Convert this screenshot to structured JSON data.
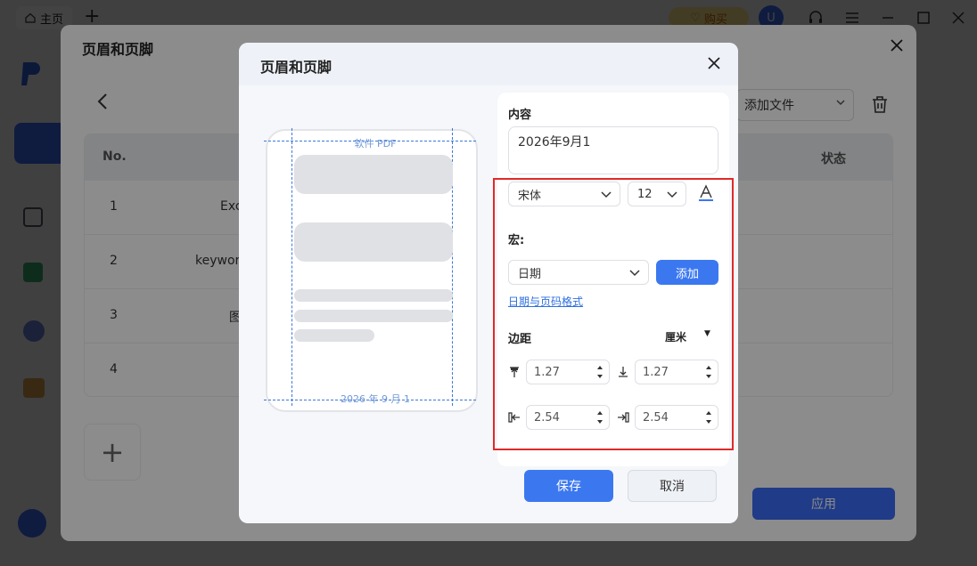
{
  "app": {
    "home_tab": "主页",
    "buy_label": "购买",
    "avatar_letter": "U"
  },
  "back_dialog": {
    "title": "页眉和页脚",
    "add_file": "添加文件",
    "table": {
      "col_no": "No.",
      "col_status": "状态",
      "rows": [
        {
          "no": "1",
          "name": "Exc"
        },
        {
          "no": "2",
          "name": "keywor"
        },
        {
          "no": "3",
          "name": "图"
        },
        {
          "no": "4",
          "name": ""
        }
      ]
    },
    "apply": "应用"
  },
  "dialog": {
    "title": "页眉和页脚",
    "preview": {
      "header_text": "软件 PDF",
      "footer_text": "2026 年 9 月 1"
    },
    "content_label": "内容",
    "content_value": "2026年9月1",
    "font": "宋体",
    "font_size": "12",
    "macro_label": "宏:",
    "macro_value": "日期",
    "add_button": "添加",
    "format_link": "日期与页码格式",
    "margin_label": "边距",
    "unit": "厘米",
    "margins": {
      "top": "1.27",
      "bottom": "1.27",
      "left": "2.54",
      "right": "2.54"
    },
    "save": "保存",
    "cancel": "取消"
  },
  "colors": {
    "accent": "#3b78f0",
    "highlight_frame": "#e02a2a"
  }
}
